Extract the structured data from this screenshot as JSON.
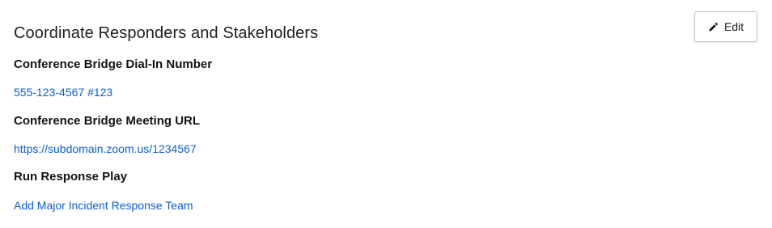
{
  "panel": {
    "title": "Coordinate Responders and Stakeholders",
    "edit_label": "Edit",
    "edit_icon": "pencil-icon"
  },
  "fields": [
    {
      "label": "Conference Bridge Dial-In Number",
      "value": "555-123-4567 #123"
    },
    {
      "label": "Conference Bridge Meeting URL",
      "value": "https://subdomain.zoom.us/1234567"
    },
    {
      "label": "Run Response Play",
      "value": "Add Major Incident Response Team"
    }
  ],
  "colors": {
    "link": "#0b5fd0",
    "label": "#141414",
    "button_border": "#c4c4c4"
  }
}
